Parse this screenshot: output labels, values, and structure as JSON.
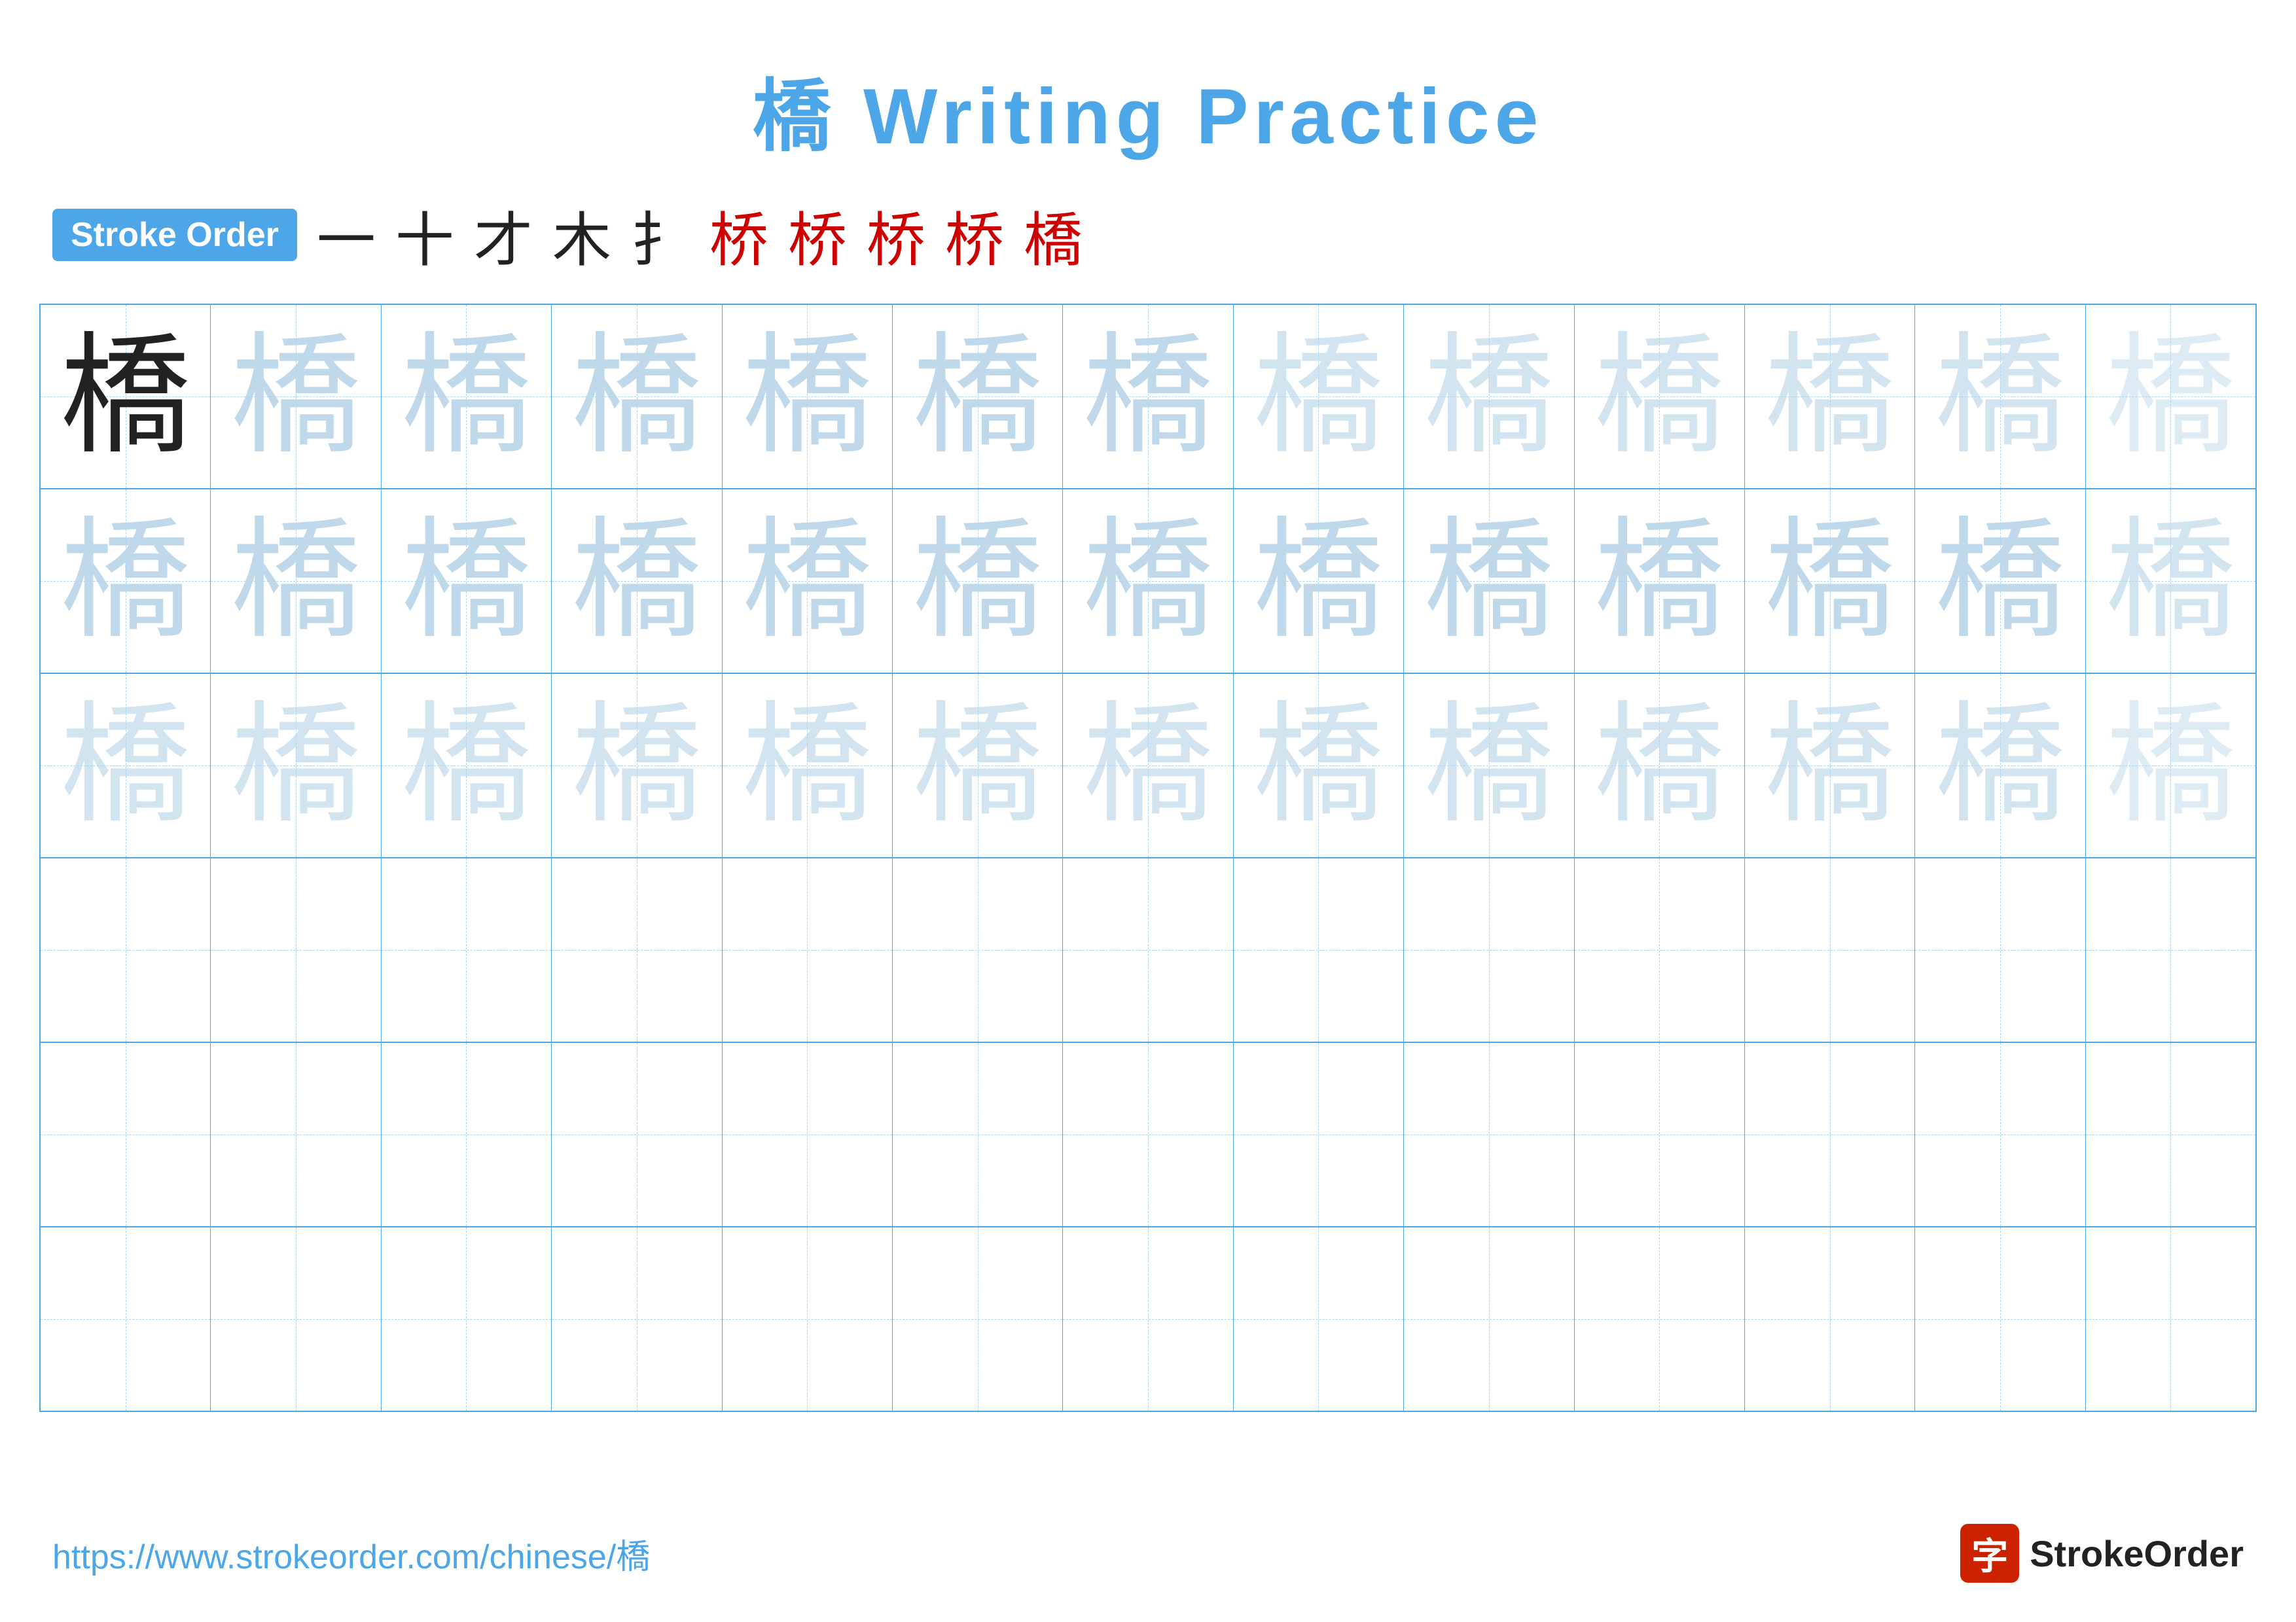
{
  "page": {
    "title": "橋 Writing Practice",
    "background_color": "#ffffff"
  },
  "stroke_order": {
    "badge_label": "Stroke Order",
    "strokes": [
      "一",
      "十",
      "才",
      "木",
      "木",
      "桥",
      "桥",
      "桥",
      "桥",
      "桥"
    ]
  },
  "grid": {
    "rows": 6,
    "cols": 13,
    "character": "橋",
    "row_types": [
      "dark-then-fading",
      "all-fading-medium",
      "all-fading-light",
      "empty",
      "empty",
      "empty"
    ]
  },
  "footer": {
    "url": "https://www.strokeorder.com/chinese/橋",
    "logo_text": "StrokeOrder",
    "logo_icon": "字"
  }
}
